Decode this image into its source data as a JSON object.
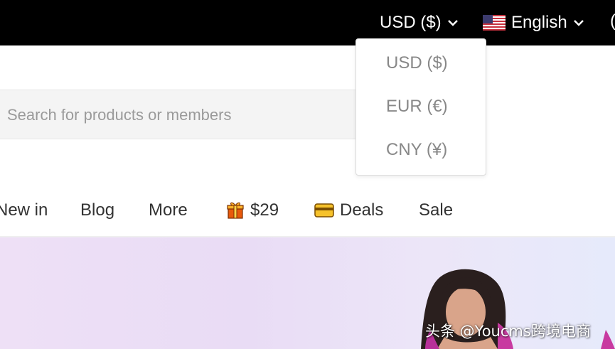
{
  "topbar": {
    "currency_label": "USD ($)",
    "language_label": "English",
    "edge_char": "("
  },
  "currency_dropdown": {
    "options": [
      "USD ($)",
      "EUR (€)",
      "CNY (¥)"
    ]
  },
  "search": {
    "placeholder": "Search for products or members"
  },
  "nav": {
    "items": [
      "New in",
      "Blog",
      "More",
      "$29",
      "Deals",
      "Sale"
    ]
  },
  "watermark": "头条 @Youcms跨境电商",
  "colors": {
    "topbar_bg": "#000000",
    "dropdown_text": "#888888",
    "nav_text": "#333333",
    "search_bg": "#f4f4f4",
    "hero_bg": "#eee0f6"
  },
  "icons": {
    "currency_toggle": "chevron-down-icon",
    "language_flag": "us-flag-icon",
    "language_toggle": "chevron-down-icon",
    "nav_price": "gift-icon",
    "nav_deals": "card-icon"
  }
}
